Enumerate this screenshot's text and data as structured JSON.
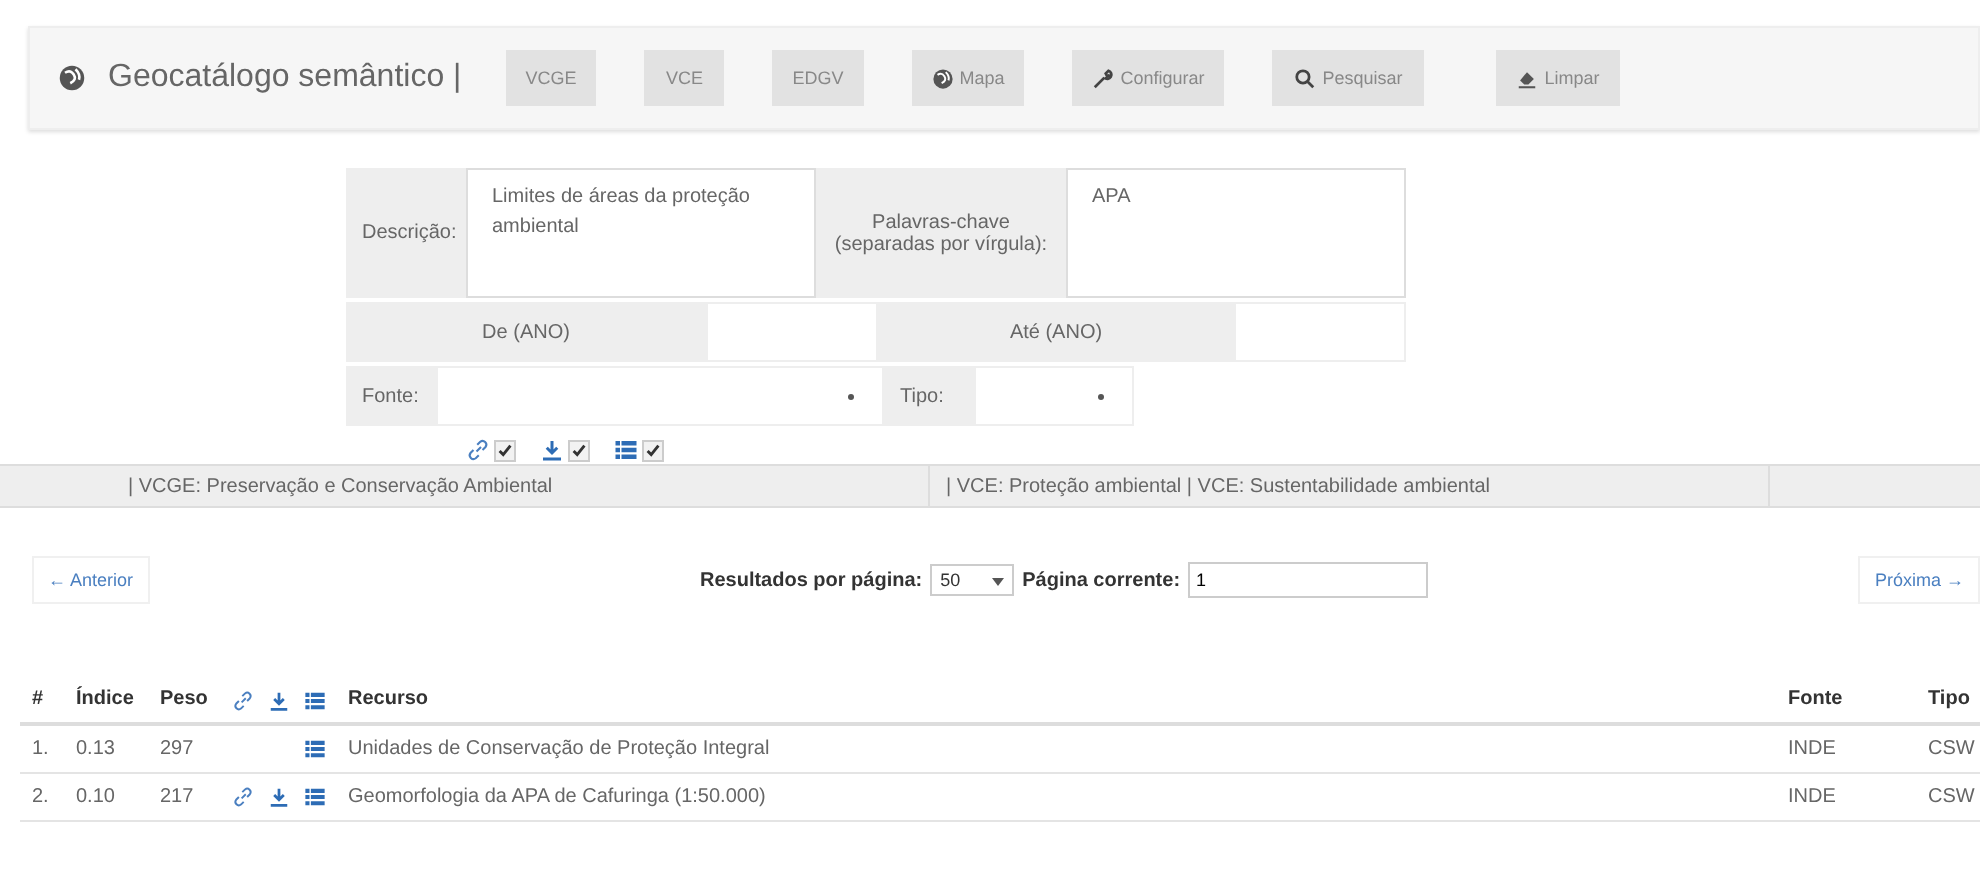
{
  "header": {
    "title": "Geocatálogo semântico |",
    "buttons": [
      "VCGE",
      "VCE",
      "EDGV",
      "Mapa",
      "Configurar",
      "Pesquisar",
      "Limpar"
    ]
  },
  "form": {
    "description_label": "Descrição:",
    "description_value": "Limites de áreas da proteção ambiental",
    "keywords_label": "Palavras-chave (separadas por vírgula):",
    "keywords_value": "APA",
    "from_label": "De  (ANO)",
    "to_label": "Até (ANO)",
    "source_label": "Fonte:",
    "type_label": "Tipo:",
    "filters": [
      {
        "checked": true
      },
      {
        "checked": true
      },
      {
        "checked": true
      }
    ]
  },
  "tags": [
    "| VCGE: Preservação e Conservação Ambiental",
    "| VCE: Proteção ambiental | VCE: Sustentabilidade ambiental"
  ],
  "pagination": {
    "previous": "← Anterior",
    "per_page_label": "Resultados por página:",
    "per_page_value": "50",
    "page_label": "Página corrente:",
    "page_value": "1",
    "next": "Próxima →"
  },
  "table": {
    "columns": [
      "#",
      "Índice",
      "Peso",
      "Recurso",
      "Fonte",
      "Tipo"
    ],
    "rows": [
      {
        "num": "1.",
        "index": "0.13",
        "weight": "297",
        "link": false,
        "download": false,
        "metadata": true,
        "resource": "Unidades de Conservação de Proteção Integral",
        "source": "INDE",
        "type": "CSW"
      },
      {
        "num": "2.",
        "index": "0.10",
        "weight": "217",
        "link": true,
        "download": true,
        "metadata": true,
        "resource": "Geomorfologia da APA de Cafuringa (1:50.000)",
        "source": "INDE",
        "type": "CSW"
      }
    ]
  }
}
